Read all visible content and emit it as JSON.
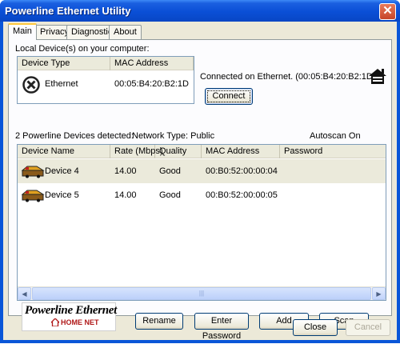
{
  "window": {
    "title": "Powerline Ethernet Utility",
    "close_label": "✕"
  },
  "tabs": [
    {
      "label": "Main",
      "active": true
    },
    {
      "label": "Privacy",
      "active": false
    },
    {
      "label": "Diagnostics",
      "active": false
    },
    {
      "label": "About",
      "active": false
    }
  ],
  "local": {
    "label": "Local Device(s) on your computer:",
    "columns": [
      "Device Type",
      "MAC Address"
    ],
    "device": {
      "icon": "network-adapter-icon",
      "type": "Ethernet",
      "mac": "00:05:B4:20:B2:1D"
    },
    "status": "Connected on Ethernet. (00:05:B4:20:B2:1D)",
    "connect_label": "Connect"
  },
  "summary": {
    "detected": "2 Powerline Devices detected:",
    "network_type": "Network Type: Public",
    "autoscan": "Autoscan On"
  },
  "devices": {
    "columns": [
      "Device Name",
      "Rate (Mbps)",
      "Quality",
      "MAC Address",
      "Password"
    ],
    "rows": [
      {
        "icon": "powerline-device-icon",
        "name": "Device 4",
        "rate": "14.00",
        "quality": "Good",
        "mac": "00:B0:52:00:00:04",
        "password": ""
      },
      {
        "icon": "powerline-device-icon",
        "name": "Device 5",
        "rate": "14.00",
        "quality": "Good",
        "mac": "00:B0:52:00:00:05",
        "password": ""
      }
    ]
  },
  "logo": {
    "main": "Powerline Ethernet",
    "sub": "HOME NET"
  },
  "buttons": {
    "rename": "Rename",
    "enter_password": "Enter Password",
    "add": "Add",
    "scan": "Scan",
    "close": "Close",
    "cancel": "Cancel"
  },
  "colors": {
    "title_bar": "#0a4fd6",
    "face": "#ece9d8",
    "selected_row": "#ebeadb",
    "logo_accent": "#b01818"
  }
}
